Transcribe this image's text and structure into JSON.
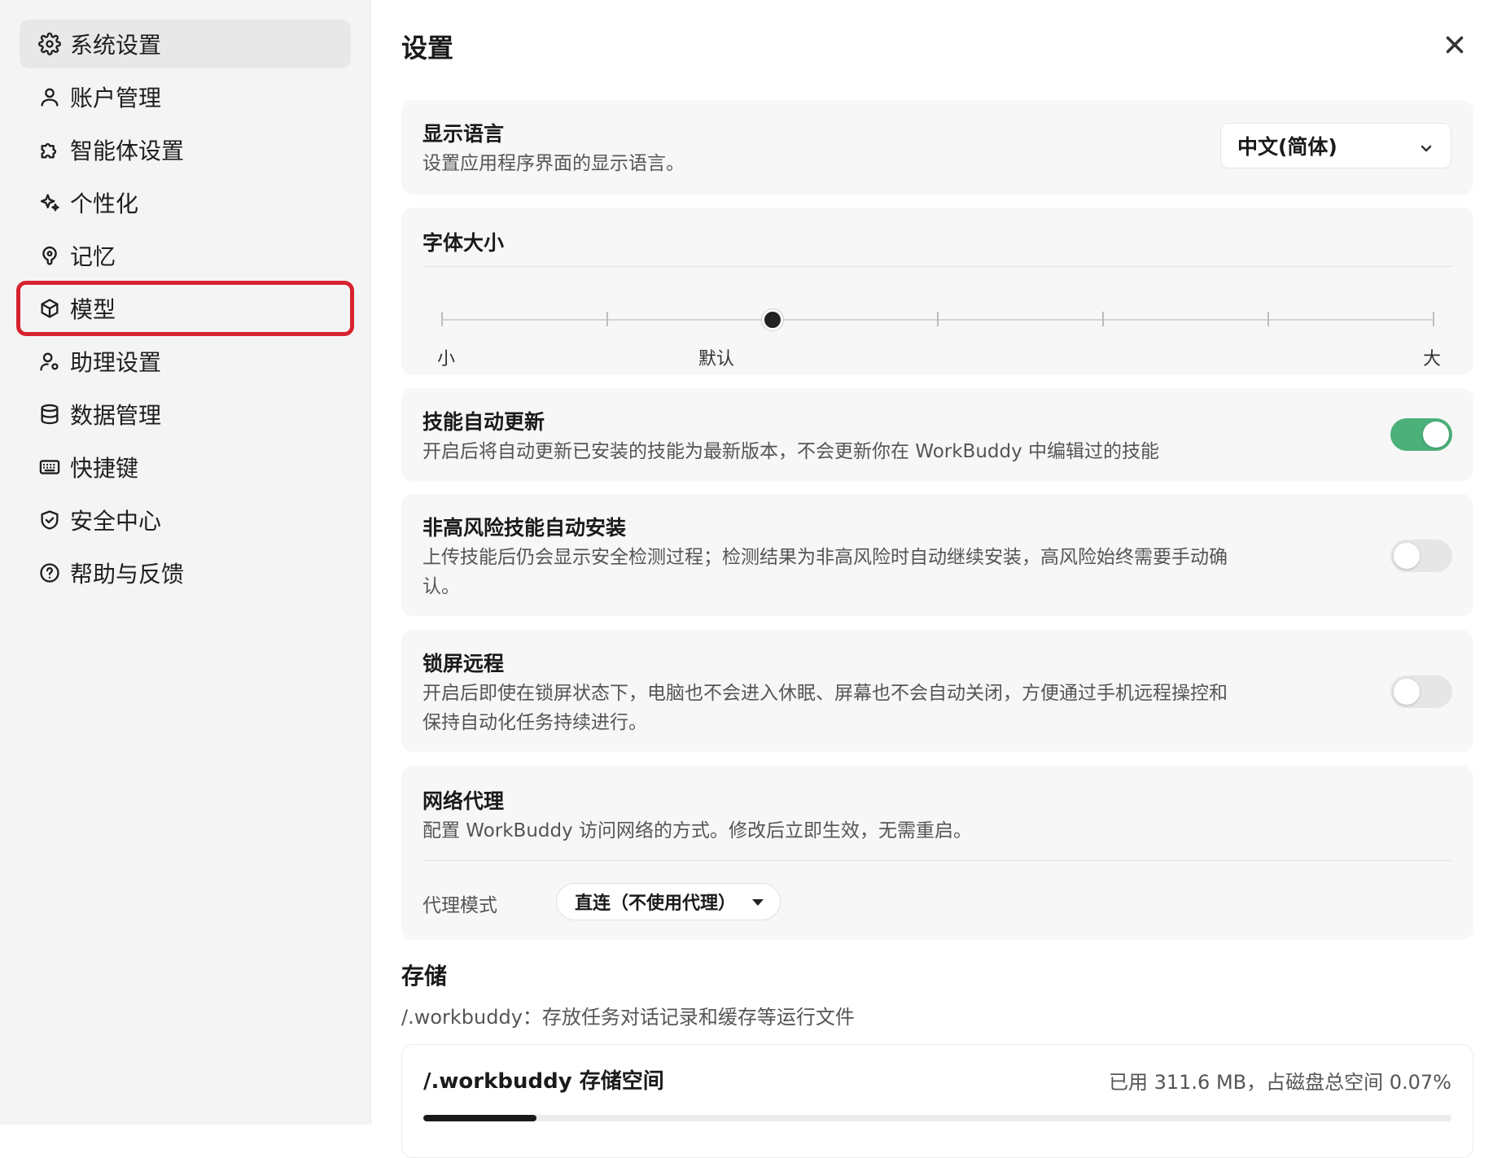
{
  "sidebar": {
    "items": [
      {
        "label": "系统设置",
        "icon": "gear-icon"
      },
      {
        "label": "账户管理",
        "icon": "user-icon"
      },
      {
        "label": "智能体设置",
        "icon": "puzzle-icon"
      },
      {
        "label": "个性化",
        "icon": "sparkle-icon"
      },
      {
        "label": "记忆",
        "icon": "brain-icon"
      },
      {
        "label": "模型",
        "icon": "cube-icon"
      },
      {
        "label": "助理设置",
        "icon": "user-gear-icon"
      },
      {
        "label": "数据管理",
        "icon": "database-icon"
      },
      {
        "label": "快捷键",
        "icon": "keyboard-icon"
      },
      {
        "label": "安全中心",
        "icon": "shield-icon"
      },
      {
        "label": "帮助与反馈",
        "icon": "help-circle-icon"
      }
    ],
    "active_index": 0,
    "highlighted_index": 5
  },
  "header": {
    "title": "设置"
  },
  "language": {
    "title": "显示语言",
    "desc": "设置应用程序界面的显示语言。",
    "selected": "中文(简体)"
  },
  "font_size": {
    "title": "字体大小",
    "labels": {
      "small": "小",
      "default": "默认",
      "large": "大"
    },
    "steps": 7,
    "value_step": 2
  },
  "skill_update": {
    "title": "技能自动更新",
    "desc": "开启后将自动更新已安装的技能为最新版本，不会更新你在 WorkBuddy 中编辑过的技能",
    "enabled": true
  },
  "auto_install": {
    "title": "非高风险技能自动安装",
    "desc": "上传技能后仍会显示安全检测过程；检测结果为非高风险时自动继续安装，高风险始终需要手动确认。",
    "enabled": false
  },
  "lock_remote": {
    "title": "锁屏远程",
    "desc": "开启后即使在锁屏状态下，电脑也不会进入休眠、屏幕也不会自动关闭，方便通过手机远程操控和保持自动化任务持续进行。",
    "enabled": false
  },
  "proxy": {
    "title": "网络代理",
    "desc": "配置 WorkBuddy 访问网络的方式。修改后立即生效，无需重启。",
    "mode_label": "代理模式",
    "mode_value": "直连（不使用代理）"
  },
  "storage": {
    "title": "存储",
    "desc": "/.workbuddy：存放任务对话记录和缓存等运行文件",
    "card_title": "/.workbuddy 存储空间",
    "usage": "已用 311.6 MB，占磁盘总空间 0.07%",
    "bar_fraction": 0.11
  },
  "colors": {
    "accent_green": "#4cb07a",
    "highlight_red": "#d7232e"
  }
}
